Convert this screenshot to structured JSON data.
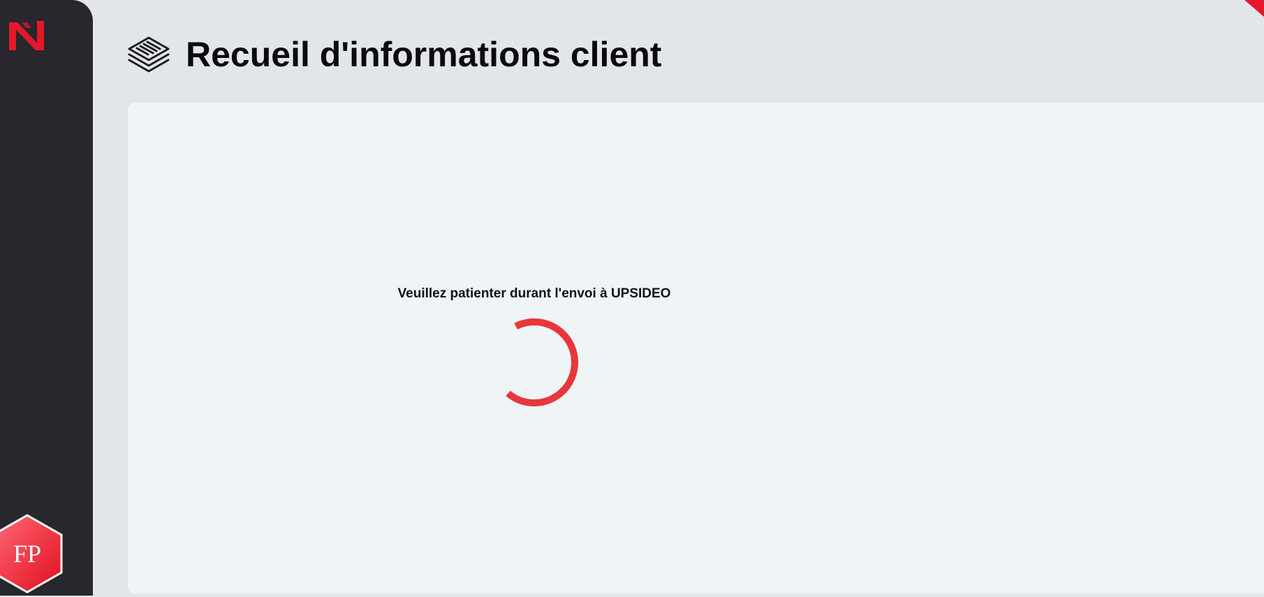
{
  "sidebar": {
    "logo_icon": "brand-n-logo-icon",
    "avatar": {
      "initials": "FP",
      "icon": "hexagon-avatar-icon"
    }
  },
  "header": {
    "icon": "stacked-documents-icon",
    "title": "Recueil d'informations client"
  },
  "main": {
    "status_message": "Veuillez patienter durant l'envoi à UPSIDEO",
    "spinner_icon": "loading-spinner-icon"
  },
  "colors": {
    "sidebar_bg": "#27272d",
    "page_bg": "#e2e6e9",
    "panel_bg": "#eff4f6",
    "accent": "#e8373a",
    "brand_red": "#e5182b"
  }
}
